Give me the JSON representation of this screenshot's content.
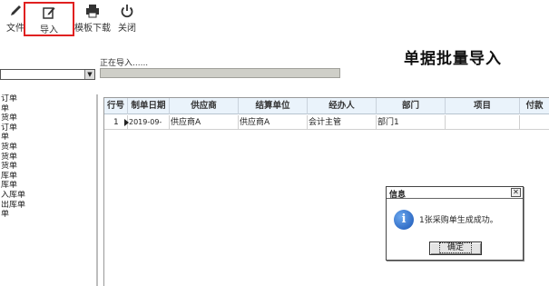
{
  "toolbar": {
    "file_label": "文件",
    "import_label": "导入",
    "template_label": "模板下载",
    "close_label": "关闭"
  },
  "title": "单据批量导入",
  "progress": {
    "label": "正在导入......",
    "value": 0
  },
  "combo": {
    "value": ""
  },
  "sidebar": {
    "items": [
      "订单",
      "单",
      "货单",
      "订单",
      "单",
      "货单",
      "货单",
      "货单",
      "库单",
      "库单",
      "入库单",
      "出库单",
      "单"
    ]
  },
  "grid": {
    "columns": [
      "行号",
      "制单日期",
      "供应商",
      "结算单位",
      "经办人",
      "部门",
      "项目",
      "付款"
    ],
    "rows": [
      {
        "row_no": "1",
        "date": "2019-09-",
        "supplier": "供应商A",
        "settle": "供应商A",
        "handler": "会计主管",
        "dept": "部门1",
        "project": "",
        "pay": ""
      }
    ]
  },
  "dialog": {
    "title": "信息",
    "message": "1张采购单生成成功。",
    "ok_label": "确定"
  },
  "colors": {
    "highlight_border": "#e02020",
    "header_bg": "#eaf3fb",
    "info_icon": "#1a55b5"
  }
}
